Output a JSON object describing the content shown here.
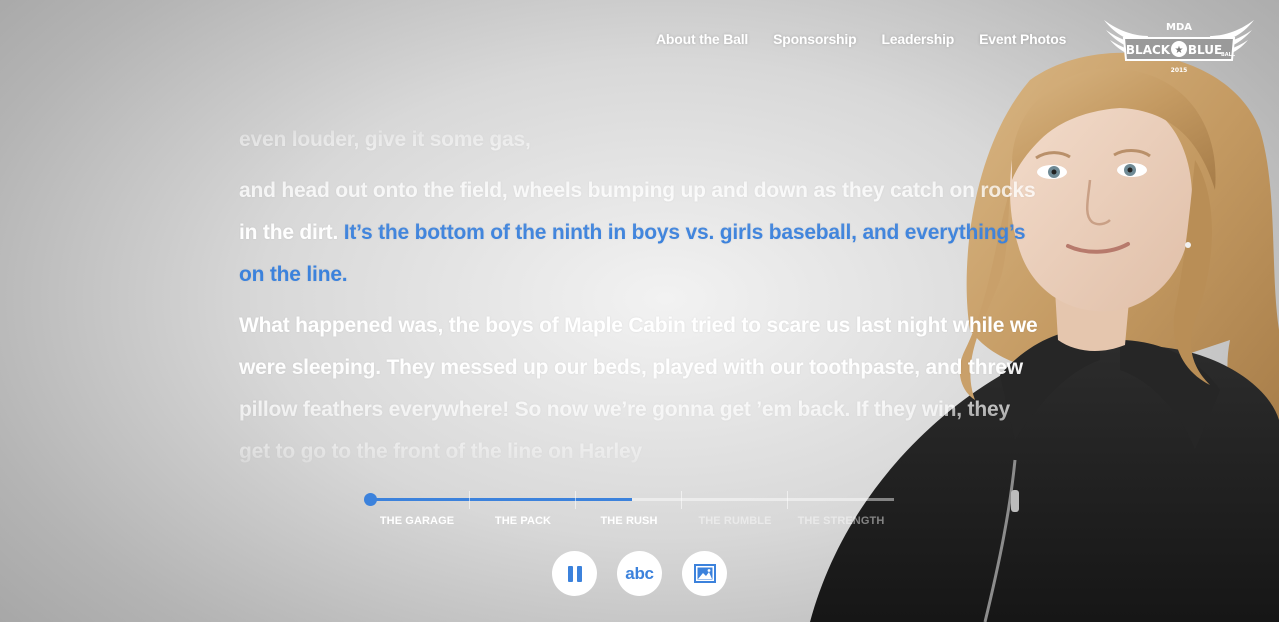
{
  "nav": {
    "items": [
      {
        "label": "About the Ball"
      },
      {
        "label": "Sponsorship"
      },
      {
        "label": "Leadership"
      },
      {
        "label": "Event Photos"
      }
    ]
  },
  "logo": {
    "top": "MDA",
    "left": "BLACK",
    "right": "BLUE",
    "ball": "BALL",
    "year": "2015"
  },
  "story": {
    "lead_line": "even louder, give it some gas,",
    "p1_normal": "and head out onto the field, wheels bumping up and down as they catch on rocks in the dirt. ",
    "p1_highlight": "It’s the bottom of the ninth in boys vs. girls baseball, and everything’s on the line.",
    "p2": "What happened was, the boys of Maple Cabin tried to scare us last night while we were sleeping. They messed up our beds, played with our toothpaste, and threw pillow feathers everywhere! So now we’re gonna get ’em back. If they win, they get to go to the front of the line on Harley"
  },
  "timeline": {
    "progress": 0.5,
    "chapters": [
      {
        "label": "THE GARAGE",
        "state": "done"
      },
      {
        "label": "THE PACK",
        "state": "done"
      },
      {
        "label": "THE RUSH",
        "state": "current"
      },
      {
        "label": "THE RUMBLE",
        "state": "upcoming"
      },
      {
        "label": "THE STRENGTH",
        "state": "upcoming"
      }
    ]
  },
  "controls": {
    "pause_icon": "pause-icon",
    "text_label": "abc",
    "image_icon": "image-icon"
  },
  "colors": {
    "accent": "#3c82dc",
    "text": "#ffffff"
  }
}
